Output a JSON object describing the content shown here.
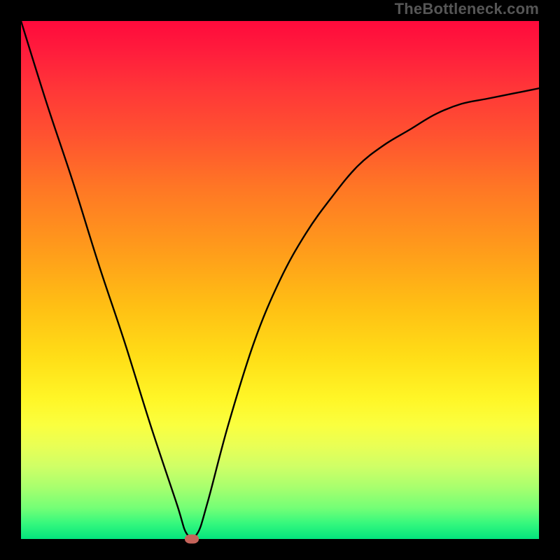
{
  "watermark": "TheBottleneck.com",
  "chart_data": {
    "type": "line",
    "title": "",
    "xlabel": "",
    "ylabel": "",
    "xlim": [
      0,
      1
    ],
    "ylim": [
      0,
      1
    ],
    "gradient_stops": [
      {
        "pos": 0.0,
        "color": "#ff0a3c"
      },
      {
        "pos": 0.5,
        "color": "#ffbf14"
      },
      {
        "pos": 0.78,
        "color": "#faff3f"
      },
      {
        "pos": 1.0,
        "color": "#03e47d"
      }
    ],
    "series": [
      {
        "name": "bottleneck-curve",
        "x": [
          0.0,
          0.05,
          0.1,
          0.15,
          0.2,
          0.25,
          0.3,
          0.32,
          0.34,
          0.36,
          0.4,
          0.45,
          0.5,
          0.55,
          0.6,
          0.65,
          0.7,
          0.75,
          0.8,
          0.85,
          0.9,
          0.95,
          1.0
        ],
        "y": [
          1.0,
          0.84,
          0.69,
          0.53,
          0.38,
          0.22,
          0.07,
          0.01,
          0.01,
          0.07,
          0.22,
          0.38,
          0.5,
          0.59,
          0.66,
          0.72,
          0.76,
          0.79,
          0.82,
          0.84,
          0.85,
          0.86,
          0.87
        ]
      }
    ],
    "marker": {
      "x": 0.33,
      "y": 0.0,
      "color": "#c5635a"
    }
  }
}
